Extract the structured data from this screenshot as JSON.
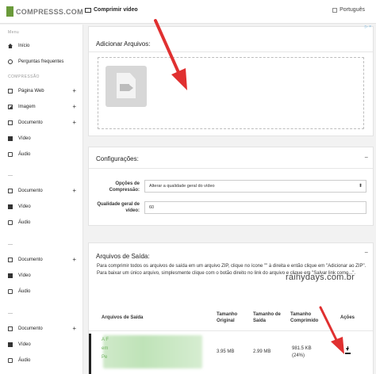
{
  "topbar": {
    "logo_text": "COMPRESSS.COM",
    "page_title": "Comprimir vídeo",
    "language": "Português"
  },
  "sidebar": {
    "section_main": "Menu",
    "home": "Início",
    "faq": "Perguntas frequentes",
    "section_compression": "COMPRESSÃO",
    "items": [
      {
        "label": "Página Web",
        "icon": "document-icon",
        "plus": "+"
      },
      {
        "label": "Imagem",
        "icon": "image-icon",
        "plus": "+"
      },
      {
        "label": "Documento",
        "icon": "document-icon",
        "plus": "+"
      },
      {
        "label": "Vídeo",
        "icon": "video-icon",
        "plus": ""
      },
      {
        "label": "Áudio",
        "icon": "audio-icon",
        "plus": ""
      }
    ],
    "groups": [
      {
        "dash": "—",
        "items": [
          "Documento",
          "Vídeo",
          "Áudio"
        ]
      },
      {
        "dash": "—",
        "items": [
          "Documento",
          "Vídeo",
          "Áudio"
        ]
      },
      {
        "dash": "—",
        "items": [
          "Documento",
          "Vídeo",
          "Áudio"
        ]
      }
    ]
  },
  "upload": {
    "title": "Adicionar Arquivos:",
    "ad_marker": "▷ ×"
  },
  "settings": {
    "title": "Configurações:",
    "compression_label": "Opções de Compressão:",
    "compression_value": "Alterar a qualidade geral do vídeo",
    "quality_label": "Qualidade geral de vídeo:",
    "quality_value": "60"
  },
  "output": {
    "title": "Arquivos de Saída:",
    "collapse": "−",
    "description": "Para comprimir todos os arquivos de saída em um arquivo ZIP, clique no ícone \"\" à direita e então clique em \"Adicionar ao ZIP\". Para baixar um único arquivo, simplesmente clique com o botão direito no link do arquivo e clique em \"Salvar link como...\".",
    "watermark": "rainydays.com.br",
    "columns": [
      "Arquivos de Saída",
      "Tamanho Original",
      "Tamanho de Saída",
      "Tamanho Comprimido",
      "Ações"
    ],
    "row": {
      "file_fragments": [
        "A F",
        "em",
        "Pe"
      ],
      "original_size": "3.95 MB",
      "output_size": "2.99 MB",
      "compressed_size": "981.5 KB",
      "compressed_pct": "(24%)"
    }
  },
  "colors": {
    "brand": "#6a9a3a",
    "arrow": "#e03030",
    "link_green": "#6fb35f"
  }
}
